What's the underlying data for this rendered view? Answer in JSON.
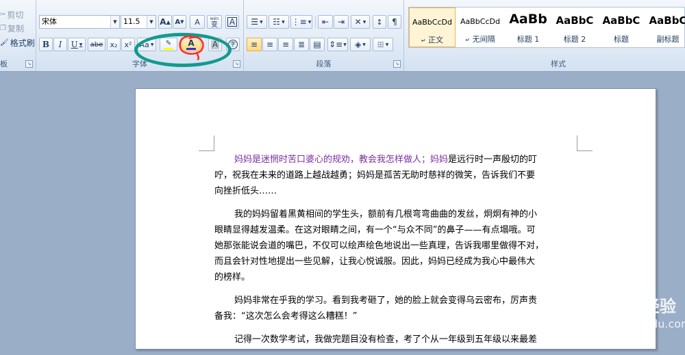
{
  "clipboard": {
    "cut_label": "剪切",
    "copy_label": "复制",
    "format_painter_label": "格式刷",
    "group_label": "板"
  },
  "font_group": {
    "font_name": "宋体",
    "font_size": "11.5",
    "grow_font": "A",
    "shrink_font": "A",
    "clear_format": "A",
    "phonetic": "wén",
    "phonetic_char": "变",
    "char_border": "A",
    "bold": "B",
    "italic": "I",
    "underline": "U",
    "strikethrough": "abe",
    "subscript": "x₂",
    "superscript": "x²",
    "change_case": "Aa",
    "font_color": "A",
    "char_shading": "A",
    "enclose": "字",
    "group_label": "字体"
  },
  "paragraph_group": {
    "group_label": "段落"
  },
  "styles_group": {
    "group_label": "样式",
    "items": [
      {
        "sample": "AaBbCcDd",
        "name": "正文"
      },
      {
        "sample": "AaBbCcDd",
        "name": "无间隔"
      },
      {
        "sample": "AaBb",
        "name": "标题 1"
      },
      {
        "sample": "AaBbC",
        "name": "标题 2"
      },
      {
        "sample": "AaBbC",
        "name": "标题"
      },
      {
        "sample": "AaBbC",
        "name": "副标题"
      }
    ]
  },
  "document": {
    "p1": {
      "l1_purple": "妈妈是迷惘时苦口婆心的规劝，教会我怎样做人；妈妈",
      "l1_rest": "是远行时一声殷切的叮",
      "l2": "咛，祝我在未来的道路上越战越勇；妈妈是孤苦无助时慈祥的微笑，告诉我们不要",
      "l3": "向挫折低头……"
    },
    "p2": {
      "l1": "我的妈妈留着黑黄相间的学生头，额前有几根弯弯曲曲的发丝，炯炯有神的小",
      "l2": "眼睛显得越发温柔。在这对眼睛之间，有一个“与众不同”的鼻子——有点塌哦。可",
      "l3": "她那张能说会道的嘴巴，不仅可以绘声绘色地说出一些真理，告诉我哪里做得不对，",
      "l4": "而且会针对性地提出一些见解，让我心悦诚服。因此，妈妈已经成为我心中最伟大",
      "l5": "的榜样。"
    },
    "p3": {
      "l1": "妈妈非常在乎我的学习。看到我考砸了，她的脸上就会变得乌云密布，厉声责",
      "l2": "备我：“这次怎么会考得这么糟糕！”"
    },
    "p4": {
      "l1": "记得一次数学考试，我做完题目没有检查，考了个从一年级到五年级以来最差"
    }
  },
  "watermark": {
    "brand": "Baidu经验",
    "url": "jingyan.baidu.com"
  },
  "colors": {
    "font_color_bar": "#3d2ec7",
    "highlight_bar": "#ffff00",
    "annotation_ellipse": "#139a8e",
    "annotation_red": "#ff2b2b",
    "purple_text": "#7b2ea0"
  }
}
